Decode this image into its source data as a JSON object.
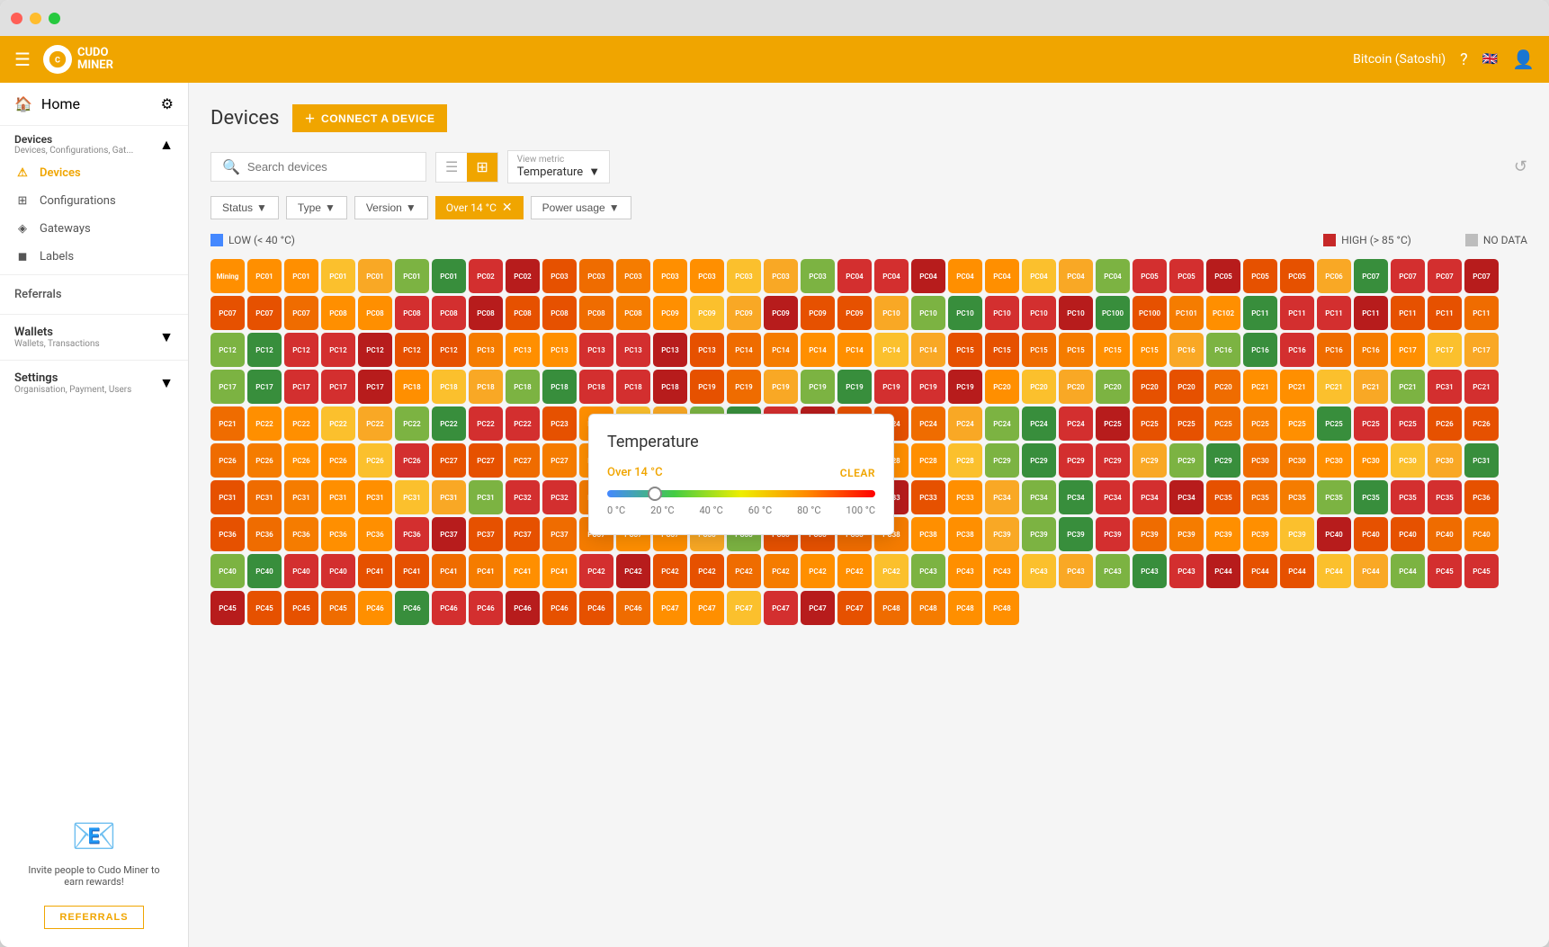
{
  "window": {
    "title": "CUDO MINER"
  },
  "topnav": {
    "currency": "Bitcoin (Satoshi)",
    "logo_text": "CUDO\nMINER"
  },
  "sidebar": {
    "home_label": "Home",
    "devices_group": {
      "title": "Devices",
      "subtitle": "Devices, Configurations, Gat...",
      "items": [
        {
          "label": "Devices",
          "active": true
        },
        {
          "label": "Configurations"
        },
        {
          "label": "Gateways"
        },
        {
          "label": "Labels"
        }
      ]
    },
    "referrals_label": "Referrals",
    "wallets_group": {
      "title": "Wallets",
      "subtitle": "Wallets, Transactions"
    },
    "settings_group": {
      "title": "Settings",
      "subtitle": "Organisation, Payment, Users"
    },
    "referral_cta": "Invite people to Cudo Miner to earn rewards!",
    "referral_btn": "REFERRALS"
  },
  "page": {
    "title": "Devices",
    "connect_btn": "CONNECT A DEVICE"
  },
  "toolbar": {
    "search_placeholder": "Search devices",
    "view_metric_label": "View metric",
    "view_metric_value": "Temperature"
  },
  "filters": {
    "status_label": "Status",
    "type_label": "Type",
    "version_label": "Version",
    "active_filter": "Over 14 °C",
    "power_usage_label": "Power usage"
  },
  "legend": {
    "low_label": "LOW (< 40 °C)",
    "high_label": "HIGH (> 85 °C)",
    "no_data_label": "NO DATA",
    "low_color": "#4488ff",
    "high_color": "#c62828",
    "no_data_color": "#bdbdbd"
  },
  "temp_popup": {
    "title": "Temperature",
    "filter_text": "Over 14 °C",
    "clear_label": "CLEAR",
    "slider_value": 14,
    "slider_labels": [
      "0 °C",
      "20 °C",
      "40 °C",
      "60 °C",
      "80 °C",
      "100 °C"
    ]
  },
  "devices": {
    "colors": [
      "c-red",
      "c-orange",
      "c-orange2",
      "c-orange3",
      "c-amber",
      "c-yellow",
      "c-green",
      "c-lime",
      "c-red-dark",
      "c-yellow2",
      "c-green2"
    ],
    "rows": [
      [
        "Mining",
        "PC01",
        "PC01",
        "PC01",
        "PC01",
        "PC01",
        "PC01",
        "PC02",
        "PC02",
        "PC03",
        "PC03",
        "PC03",
        "PC03",
        "PC03",
        "PC03",
        "PC03",
        "PC03",
        "PC04",
        "PC04",
        "PC04",
        "PC04",
        "PC04",
        "PC04"
      ],
      [
        "PC04",
        "PC04",
        "PC05",
        "PC05",
        "PC05",
        "PC05",
        "PC05",
        "PC06",
        "PC07",
        "PC07",
        "PC07",
        "PC07",
        "PC07",
        "PC07",
        "PC07",
        "PC08",
        "PC08",
        "PC08",
        "PC08",
        "PC08",
        "PC08",
        "PC08",
        "PC08"
      ],
      [
        "PC08",
        "PC09",
        "PC09",
        "PC09",
        "PC09",
        "PC09",
        "PC09",
        "PC10",
        "PC10",
        "PC10",
        "PC10",
        "PC10",
        "PC10",
        "PC100",
        "PC100",
        "PC101",
        "PC102",
        "PC11",
        "PC11",
        "PC11",
        "PC11",
        "PC11",
        "PC11",
        "PC11",
        "PC12"
      ],
      [
        "PC12",
        "PC12",
        "PC12",
        "PC12",
        "PC12",
        "PC12",
        "PC13",
        "PC13",
        "PC13",
        "PC13",
        "PC13",
        "PC13",
        "PC13",
        "PC14",
        "PC14",
        "PC14",
        "PC14",
        "PC14",
        "PC14",
        "PC15",
        "PC15",
        "PC15",
        "PC15",
        "PC15",
        "PC15",
        "PC16"
      ],
      [
        "PC16",
        "PC16",
        "PC16",
        "PC16",
        "PC16",
        "PC17",
        "PC17",
        "PC17",
        "PC17",
        "PC17",
        "PC17",
        "PC17",
        "PC17",
        "PC18",
        "PC18",
        "PC18",
        "PC18",
        "PC18",
        "PC18",
        "PC18",
        "PC18",
        "PC19",
        "PC19",
        "PC19",
        "PC19",
        "PC19",
        "PC19"
      ],
      [
        "PC19",
        "PC19",
        "PC20",
        "PC20",
        "PC20",
        "PC20",
        "PC20",
        "PC20",
        "PC20",
        "PC21",
        "PC21",
        "PC21",
        "PC21",
        "PC21",
        "PC31",
        "PC21",
        "PC21",
        "PC22",
        "PC22",
        "PC22",
        "PC22",
        "PC22",
        "PC22",
        "PC22",
        "PC22",
        "PC23",
        "PC23"
      ],
      [
        "PC23",
        "PC23",
        "PC23",
        "PC23",
        "PC23",
        "PC24",
        "PC24",
        "PC24",
        "PC24",
        "PC24",
        "PC24",
        "PC24",
        "PC24",
        "PC25",
        "PC25",
        "PC25",
        "PC25",
        "PC25",
        "PC25",
        "PC25",
        "PC25",
        "PC25",
        "PC26",
        "PC26",
        "PC26",
        "PC26",
        "PC26"
      ],
      [
        "PC26",
        "PC26",
        "PC26",
        "PC27",
        "PC27",
        "PC27",
        "PC27",
        "PC27",
        "PC27",
        "PC27",
        "PC27",
        "PC28",
        "PC28",
        "PC28",
        "PC28",
        "PC28",
        "PC28",
        "PC28",
        "PC29",
        "PC29",
        "PC29",
        "PC29",
        "PC29",
        "PC29",
        "PC29",
        "PC30"
      ],
      [
        "PC30",
        "PC30",
        "PC30",
        "PC30",
        "PC30",
        "PC31",
        "PC31",
        "PC31",
        "PC31",
        "PC31",
        "PC31",
        "PC31",
        "PC31",
        "PC31",
        "PC32",
        "PC32",
        "PC32",
        "PC32",
        "PC32",
        "PC32",
        "PC33",
        "PC33",
        "PC33",
        "PC33",
        "PC33",
        "PC33",
        "PC33"
      ],
      [
        "PC34",
        "PC34",
        "PC34",
        "PC34",
        "PC34",
        "PC34",
        "PC35",
        "PC35",
        "PC35",
        "PC35",
        "PC35",
        "PC35",
        "PC35",
        "PC36",
        "PC36",
        "PC36",
        "PC36",
        "PC36",
        "PC36",
        "PC36",
        "PC37",
        "PC37",
        "PC37",
        "PC37"
      ],
      [
        "PC37",
        "PC37",
        "PC37",
        "PC38",
        "PC38",
        "PC38",
        "PC38",
        "PC38",
        "PC38",
        "PC38",
        "PC38",
        "PC39",
        "PC39",
        "PC39",
        "PC39",
        "PC39",
        "PC39",
        "PC39",
        "PC39",
        "PC39",
        "PC40",
        "PC40",
        "PC40",
        "PC40",
        "PC40",
        "PC40",
        "PC40",
        "PC40",
        "PC40",
        "PC41"
      ],
      [
        "PC41",
        "PC41",
        "PC41",
        "PC41",
        "PC41",
        "PC42",
        "PC42",
        "PC42",
        "PC42",
        "PC42",
        "PC42",
        "PC42",
        "PC42",
        "PC42",
        "PC43",
        "PC43",
        "PC43",
        "PC43",
        "PC43",
        "PC43",
        "PC43",
        "PC43",
        "PC44",
        "PC44",
        "PC44",
        "PC44",
        "PC44",
        "PC44"
      ],
      [
        "PC45",
        "PC45",
        "PC45",
        "PC45",
        "PC45",
        "PC45",
        "PC46",
        "PC46",
        "PC46",
        "PC46",
        "PC46",
        "PC46",
        "PC46",
        "PC46",
        "PC47",
        "PC47",
        "PC47",
        "PC47",
        "PC47",
        "PC47",
        "PC48",
        "PC48",
        "PC48",
        "PC48"
      ]
    ]
  }
}
